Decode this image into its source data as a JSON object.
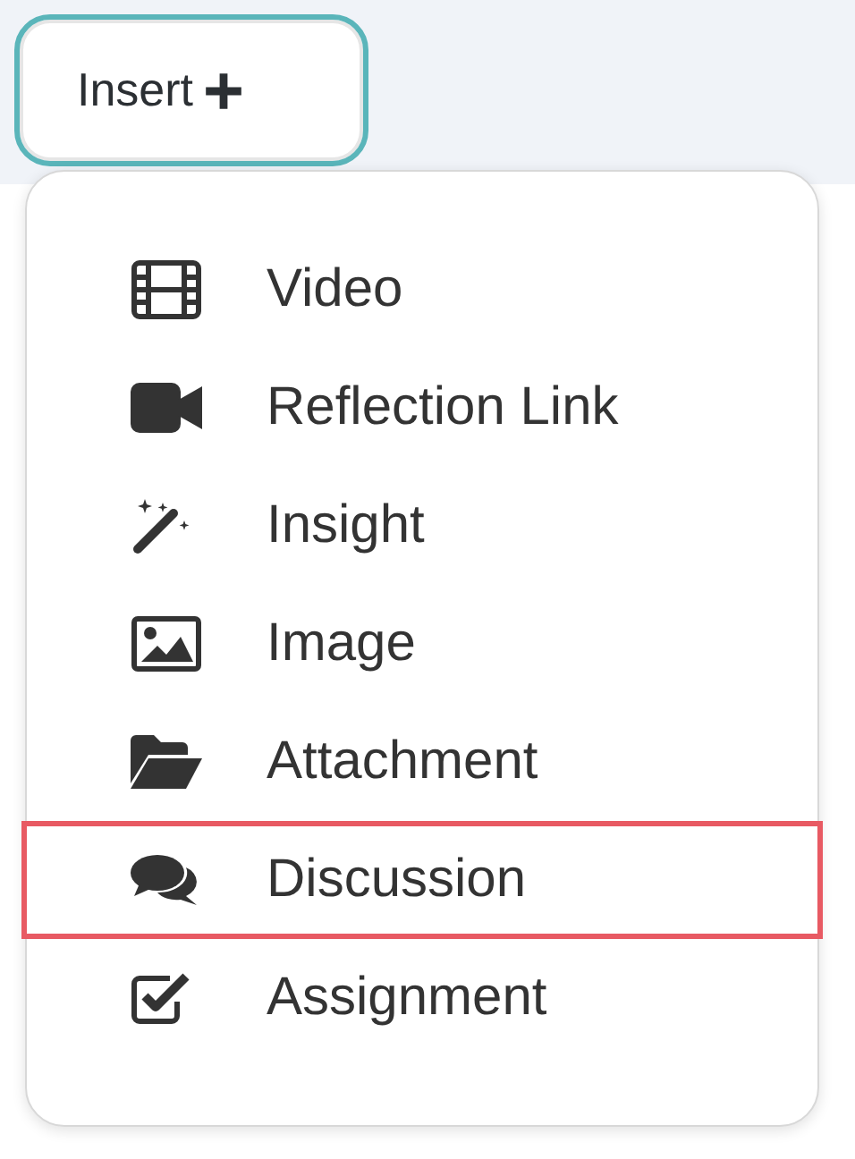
{
  "insert_button": {
    "label": "Insert"
  },
  "menu": {
    "items": [
      {
        "kind": "video",
        "label": "Video",
        "selected": false
      },
      {
        "kind": "camera",
        "label": "Reflection Link",
        "selected": false
      },
      {
        "kind": "wand",
        "label": "Insight",
        "selected": false
      },
      {
        "kind": "image",
        "label": "Image",
        "selected": false
      },
      {
        "kind": "folder",
        "label": "Attachment",
        "selected": false
      },
      {
        "kind": "comments",
        "label": "Discussion",
        "selected": true
      },
      {
        "kind": "checkbox",
        "label": "Assignment",
        "selected": false
      }
    ]
  }
}
